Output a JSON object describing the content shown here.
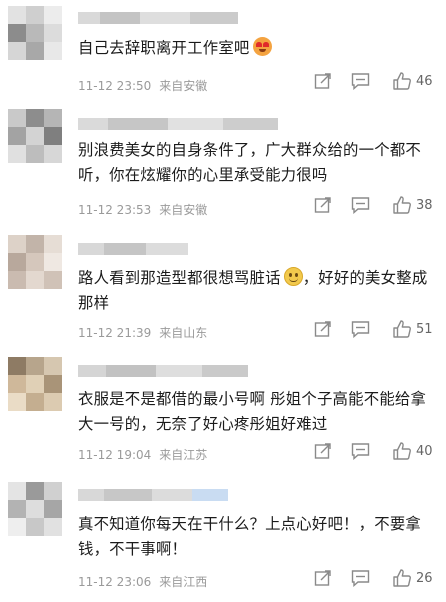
{
  "comments": [
    {
      "text": "自己去辞职离开工作室吧",
      "emoji": "heart-eyes",
      "time": "11-12 23:50",
      "location": "来自安徽",
      "likes": "46"
    },
    {
      "text": "别浪费美女的自身条件了，广大群众给的一个都不听，你在炫耀你的心里承受能力很吗",
      "time": "11-12 23:53",
      "location": "来自安徽",
      "likes": "38"
    },
    {
      "text_a": "路人看到那造型都很想骂脏话",
      "emoji": "smile",
      "text_b": "，好好的美女整成那样",
      "time": "11-12 21:39",
      "location": "来自山东",
      "likes": "51"
    },
    {
      "text": "衣服是不是都借的最小号啊 彤姐个子高能不能给拿大一号的，无奈了好心疼彤姐好难过",
      "time": "11-12 19:04",
      "location": "来自江苏",
      "likes": "40"
    },
    {
      "text": "真不知道你每天在干什么？上点心好吧！，不要拿钱，不干事啊！",
      "time": "11-12 23:06",
      "location": "来自江西",
      "likes": "26"
    }
  ],
  "colors": {
    "meta_gray": "#9a9a9a",
    "icon_gray": "#8a8a8a",
    "text": "#1b1b1b"
  },
  "icons": [
    "share-icon",
    "comment-icon",
    "like-icon"
  ]
}
